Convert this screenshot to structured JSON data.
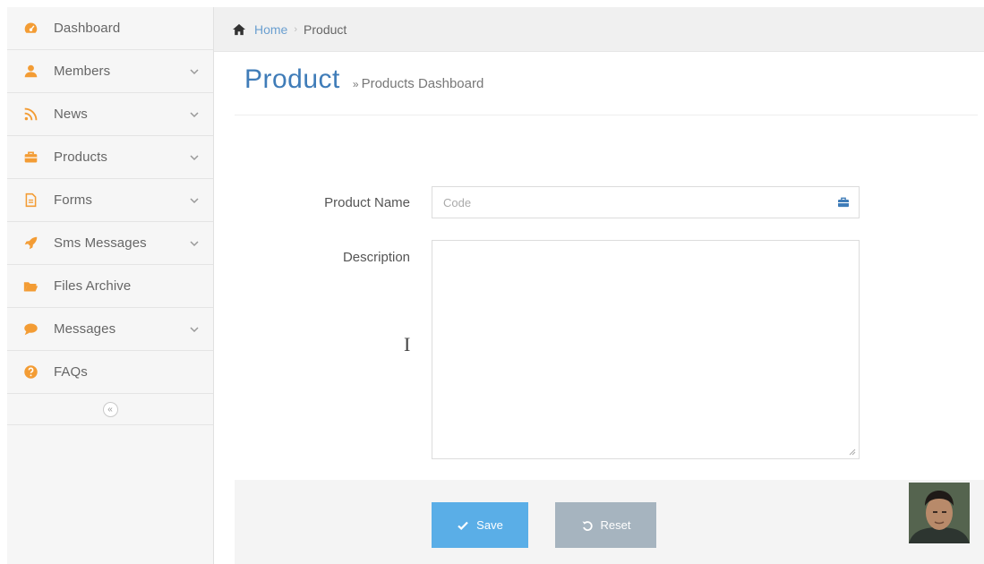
{
  "sidebar": {
    "items": [
      {
        "label": "Dashboard",
        "icon": "dashboard-icon",
        "expandable": false
      },
      {
        "label": "Members",
        "icon": "user-icon",
        "expandable": true
      },
      {
        "label": "News",
        "icon": "rss-icon",
        "expandable": true
      },
      {
        "label": "Products",
        "icon": "briefcase-icon",
        "expandable": true
      },
      {
        "label": "Forms",
        "icon": "file-icon",
        "expandable": true
      },
      {
        "label": "Sms Messages",
        "icon": "rocket-icon",
        "expandable": true
      },
      {
        "label": "Files Archive",
        "icon": "folder-open-icon",
        "expandable": false
      },
      {
        "label": "Messages",
        "icon": "comment-icon",
        "expandable": true
      },
      {
        "label": "FAQs",
        "icon": "question-circle-icon",
        "expandable": false
      }
    ],
    "collapse_glyph": "«"
  },
  "breadcrumb": {
    "home": "Home",
    "separator": "›",
    "current": "Product"
  },
  "header": {
    "title": "Product",
    "subtitle_marker": "»",
    "subtitle": "Products Dashboard"
  },
  "form": {
    "product_name_label": "Product Name",
    "product_name_placeholder": "Code",
    "product_name_value": "",
    "description_label": "Description",
    "description_value": "",
    "cursor_glyph": "I"
  },
  "actions": {
    "save_label": "Save",
    "reset_label": "Reset"
  },
  "colors": {
    "accent_orange": "#f39c34",
    "title_blue": "#3f7cb8",
    "save_button": "#5aaee7",
    "reset_button": "#a6b4bf"
  }
}
